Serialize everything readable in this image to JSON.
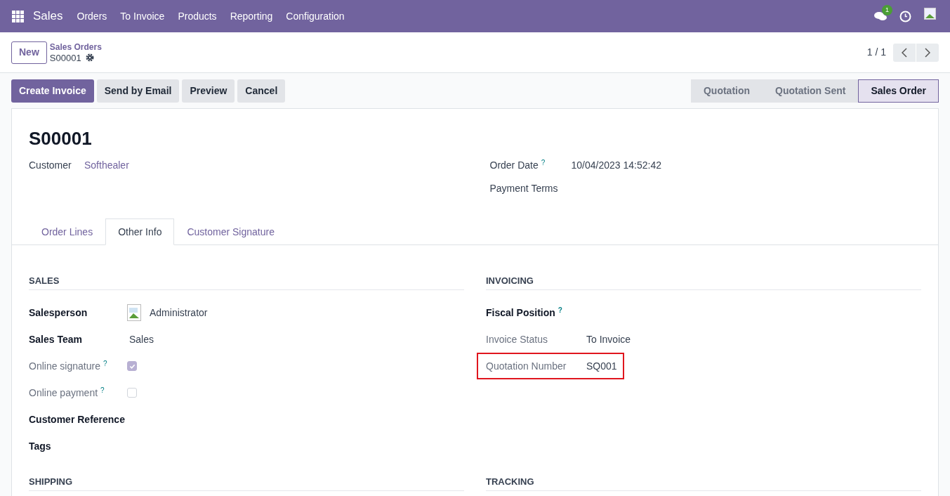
{
  "navbar": {
    "app": "Sales",
    "menu": [
      "Orders",
      "To Invoice",
      "Products",
      "Reporting",
      "Configuration"
    ],
    "chat_count": "1"
  },
  "control_panel": {
    "new_button": "New",
    "breadcrumb": "Sales Orders",
    "record": "S00001",
    "pager": "1 / 1"
  },
  "actions": [
    {
      "label": "Create Invoice",
      "primary": true
    },
    {
      "label": "Send by Email",
      "primary": false
    },
    {
      "label": "Preview",
      "primary": false
    },
    {
      "label": "Cancel",
      "primary": false
    }
  ],
  "statusbar": [
    {
      "label": "Quotation",
      "selected": false
    },
    {
      "label": "Quotation Sent",
      "selected": false
    },
    {
      "label": "Sales Order",
      "selected": true
    }
  ],
  "form": {
    "title": "S00001",
    "left_fields": [
      {
        "label": "Customer",
        "value": "Softhealer",
        "link": true
      }
    ],
    "right_fields": [
      {
        "label": "Order Date",
        "help": "?",
        "value": "10/04/2023 14:52:42"
      },
      {
        "label": "Payment Terms"
      }
    ],
    "tabs": [
      {
        "label": "Order Lines",
        "selected": false
      },
      {
        "label": "Other Info",
        "selected": true
      },
      {
        "label": "Customer Signature",
        "selected": false
      }
    ],
    "sections": [
      {
        "title": "SALES",
        "fields": [
          {
            "kind": "avatar",
            "label": "Salesperson",
            "readonly": false,
            "value": "Administrator"
          },
          {
            "kind": "text",
            "label": "Sales Team",
            "readonly": false,
            "value": "Sales"
          },
          {
            "kind": "checkbox",
            "label": "Online signature",
            "help": "?",
            "readonly": true,
            "checked": true
          },
          {
            "kind": "checkbox",
            "label": "Online payment",
            "help": "?",
            "readonly": true,
            "checked": false
          },
          {
            "kind": "text",
            "label": "Customer Reference",
            "readonly": false
          },
          {
            "kind": "text",
            "label": "Tags",
            "readonly": false
          }
        ]
      },
      {
        "title": "INVOICING",
        "fields": [
          {
            "kind": "text",
            "label": "Fiscal Position",
            "help": "?",
            "readonly": false
          },
          {
            "kind": "text",
            "label": "Invoice Status",
            "readonly": true,
            "value": "To Invoice"
          },
          {
            "kind": "text",
            "label": "Quotation Number",
            "readonly": true,
            "value": "SQ001",
            "highlighted": true
          }
        ]
      },
      {
        "title": "SHIPPING"
      },
      {
        "title": "TRACKING"
      }
    ]
  }
}
